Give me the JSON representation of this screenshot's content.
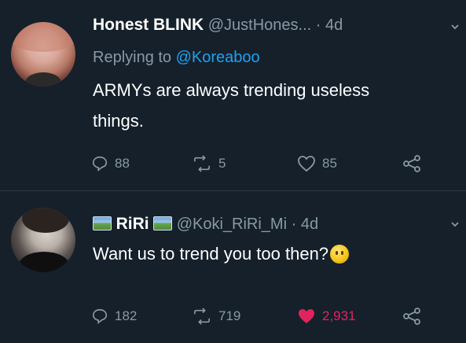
{
  "tweets": [
    {
      "display_name": "Honest BLINK",
      "handle": "@JustHones...",
      "separator": "·",
      "time": "4d",
      "reply_prefix": "Replying to",
      "reply_to": "@Koreaboo",
      "text_line1": "ARMYs are always trending useless",
      "text_line2": "things.",
      "replies": "88",
      "retweets": "5",
      "likes": "85",
      "liked": false
    },
    {
      "display_name": "RiRi",
      "handle": "@Koki_RiRi_Mi",
      "separator": "·",
      "time": "4d",
      "text_line1": "Want us to trend you too then?",
      "emoji": "thinking-face",
      "replies": "182",
      "retweets": "719",
      "likes": "2,931",
      "liked": true
    }
  ],
  "colors": {
    "background": "#15202b",
    "muted": "#8899a6",
    "link": "#1da1f2",
    "like_active": "#e0245e"
  },
  "icons": [
    "reply-icon",
    "retweet-icon",
    "like-icon",
    "share-icon",
    "chevron-down-icon"
  ]
}
